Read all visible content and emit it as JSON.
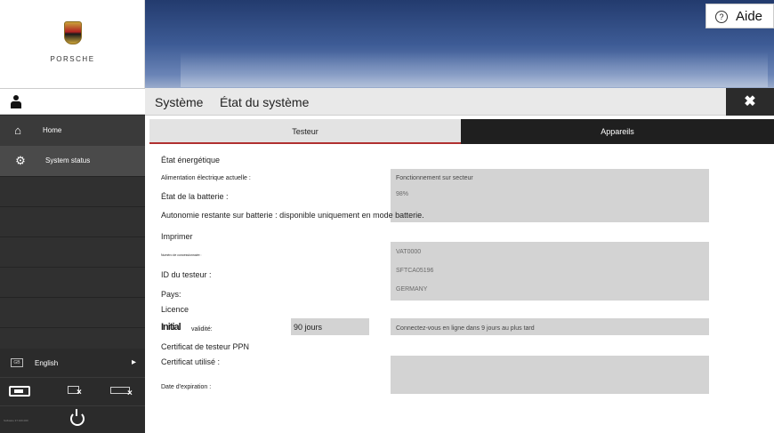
{
  "brand": {
    "name": "PORSCHE"
  },
  "help": {
    "label": "Aide",
    "icon": "help-circle-icon"
  },
  "titlebar": {
    "crumb_root": "Système",
    "crumb_page": "État du système",
    "close_icon": "close-icon"
  },
  "sidebar": {
    "items": [
      {
        "label": "Home",
        "icon": "home-icon"
      },
      {
        "label": "System status",
        "icon": "gear-icon"
      }
    ],
    "language": {
      "flag_text": "GB",
      "label": "English"
    },
    "version_text": "Software 37.100.000"
  },
  "tabs": [
    {
      "label": "Testeur",
      "active": true
    },
    {
      "label": "Appareils",
      "active": false
    }
  ],
  "energy": {
    "heading": "État énergétique",
    "supply_label": "Alimentation électrique actuelle :",
    "supply_value": "Fonctionnement sur secteur",
    "battery_label": "État de la batterie :",
    "battery_value": "98%",
    "autonomy_text": "Autonomie restante sur batterie : disponible uniquement en mode batterie."
  },
  "printer": {
    "heading": "Imprimer",
    "dealer_label": "Numéro de concessionnaire :",
    "dealer_value": "VAT0000",
    "tester_label": "ID du testeur :",
    "tester_value": "SFTCA05196",
    "country_label": "Pays:",
    "country_value": "GERMANY"
  },
  "license": {
    "heading": "Licence",
    "validity_label_prefix": "Initial",
    "validity_label": "validité:",
    "validity_value": "90 jours",
    "validity_note": "Connectez-vous en ligne dans 9 jours au plus tard"
  },
  "ppn": {
    "heading": "Certificat de testeur PPN",
    "cert_label": "Certificat utilisé :",
    "expiry_label": "Date d'expiration :"
  }
}
